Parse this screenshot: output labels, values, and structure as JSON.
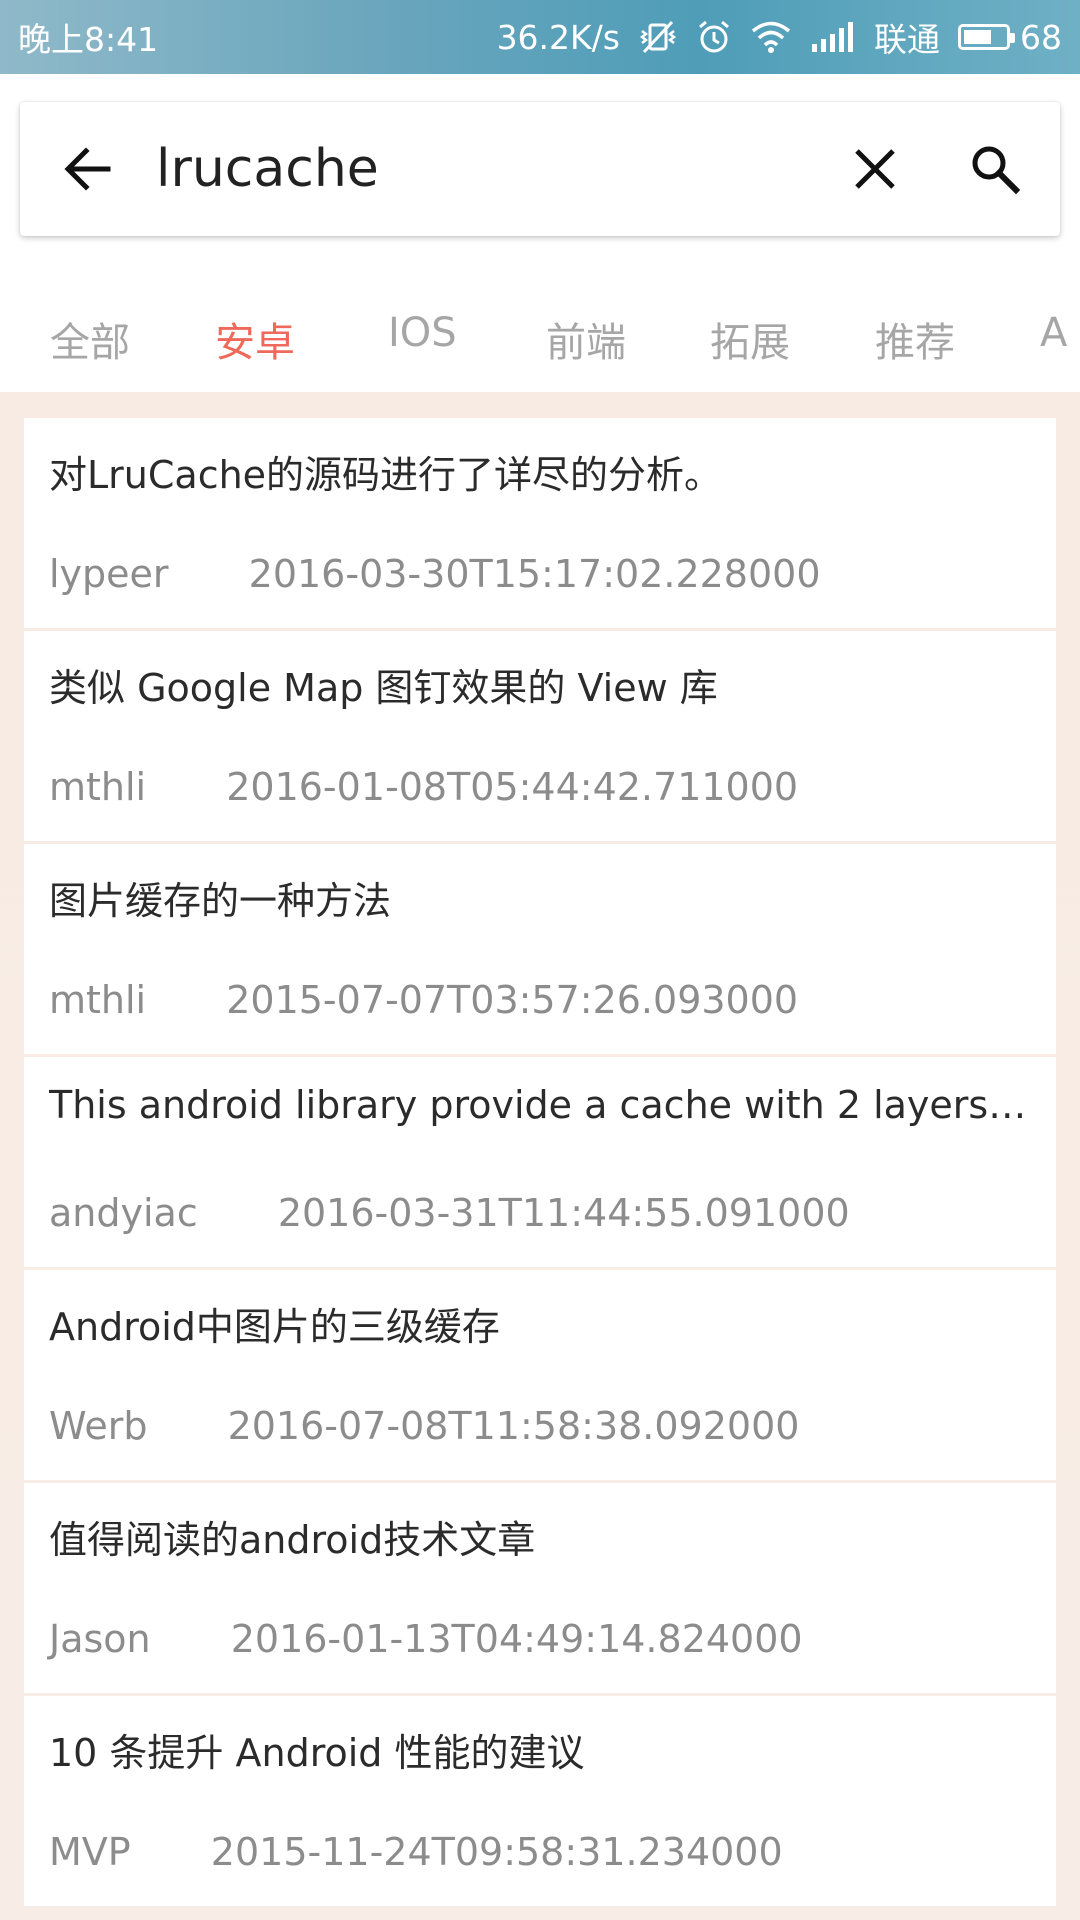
{
  "status_bar": {
    "time": "晚上8:41",
    "network_speed": "36.2K/s",
    "carrier": "联通",
    "battery": "68",
    "battery_level": 0.68,
    "icons": [
      "vibrate-off-icon",
      "alarm-icon",
      "wifi-icon",
      "signal-icon",
      "battery-icon"
    ]
  },
  "search": {
    "value": "lrucache",
    "back_icon": "arrow-left-icon",
    "clear_icon": "close-icon",
    "search_icon": "search-icon"
  },
  "tabs": [
    {
      "label": "全部",
      "active": false
    },
    {
      "label": "安卓",
      "active": true
    },
    {
      "label": "IOS",
      "active": false
    },
    {
      "label": "前端",
      "active": false
    },
    {
      "label": "拓展",
      "active": false
    },
    {
      "label": "推荐",
      "active": false
    },
    {
      "label": "A",
      "active": false
    }
  ],
  "colors": {
    "active_tab": "#ef6a5b",
    "inactive_tab": "#a6a6a6",
    "status_bar": "#5fa5bd",
    "list_background": "#f7ebe4"
  },
  "results": [
    {
      "title": "对LruCache的源码进行了详尽的分析。",
      "author": "lypeer",
      "date": "2016-03-30T15:17:02.228000"
    },
    {
      "title": "类似 Google Map 图钉效果的 View 库",
      "author": "mthli",
      "date": "2016-01-08T05:44:42.711000"
    },
    {
      "title": "图片缓存的一种方法",
      "author": "mthli",
      "date": "2015-07-07T03:57:26.093000"
    },
    {
      "title": "This android library provide a cache with 2 layers,...",
      "author": "andyiac",
      "date": "2016-03-31T11:44:55.091000"
    },
    {
      "title": "Android中图片的三级缓存",
      "author": "Werb",
      "date": "2016-07-08T11:58:38.092000"
    },
    {
      "title": "值得阅读的android技术文章",
      "author": "Jason",
      "date": "2016-01-13T04:49:14.824000"
    },
    {
      "title": "10 条提升 Android 性能的建议",
      "author": "MVP",
      "date": "2015-11-24T09:58:31.234000"
    }
  ]
}
